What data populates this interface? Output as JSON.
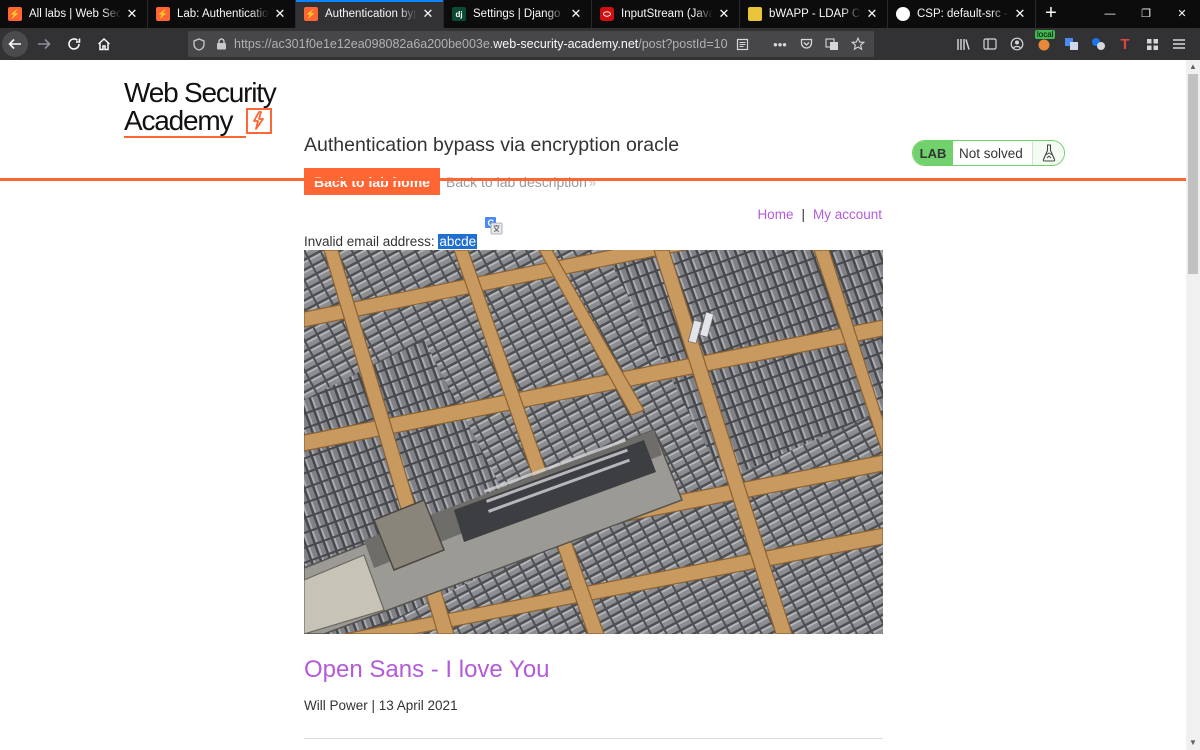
{
  "browser": {
    "tabs": [
      {
        "title": "All labs | Web Security",
        "favicon": "wsa-icon",
        "active": false
      },
      {
        "title": "Lab: Authentication by",
        "favicon": "wsa-icon",
        "active": false
      },
      {
        "title": "Authentication bypass",
        "favicon": "wsa-icon",
        "active": true
      },
      {
        "title": "Settings | Django docu",
        "favicon": "django-icon",
        "active": false
      },
      {
        "title": "InputStream (Java Platf",
        "favicon": "oracle-icon",
        "active": false
      },
      {
        "title": "bWAPP - LDAP Connec",
        "favicon": "bwapp-icon",
        "active": false
      },
      {
        "title": "CSP: default-src - HTTP",
        "favicon": "mdn-icon",
        "active": false
      }
    ],
    "favicon_labels": {
      "dj": "dj"
    },
    "url": {
      "prefix": "https://ac301f0e1e12ea098082a6a200be003e.",
      "domain": "web-security-academy.net",
      "path": "/post?postId=10"
    },
    "toolbar_badge": "local"
  },
  "site": {
    "logo_line1": "Web Security",
    "logo_line2": "Academy",
    "lab_title": "Authentication bypass via encryption oracle",
    "back_home_label": "Back to lab home",
    "back_description_label": "Back to lab description",
    "status": {
      "tag": "LAB",
      "text": "Not solved",
      "color": "#70d16d"
    }
  },
  "nav": {
    "home": "Home",
    "separator": "|",
    "account": "My account"
  },
  "notice": {
    "label": "Invalid email address: ",
    "value": "abcde"
  },
  "post": {
    "image_alt": "Printer's type case with metal letters and composing stick",
    "title": "Open Sans - I love You",
    "meta": "Will Power | 13 April 2021"
  },
  "colors": {
    "accent": "#ff6633",
    "link": "#b35bd9",
    "tab_active_indicator": "#0a84ff"
  }
}
